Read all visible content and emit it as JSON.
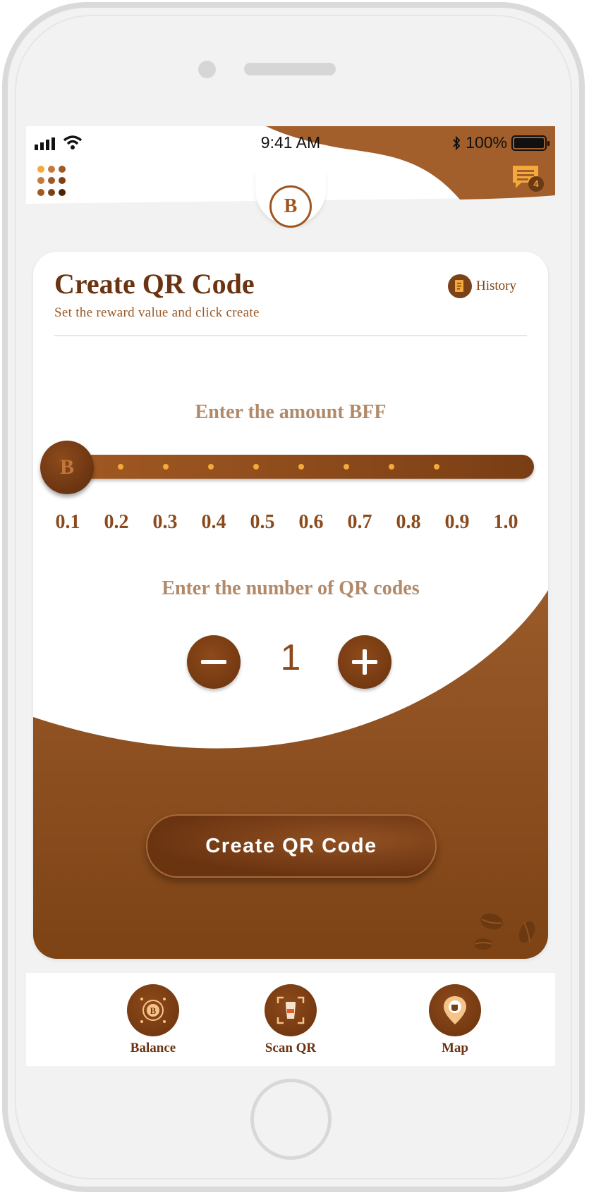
{
  "status_bar": {
    "time": "9:41 AM",
    "battery": "100%"
  },
  "header": {
    "chat_badge_count": "4",
    "logo_text": "B"
  },
  "card": {
    "title": "Create QR Code",
    "subtitle": "Set the reward value and click create",
    "history_label": "History",
    "amount_label": "Enter the amount BFF",
    "slider": {
      "ticks": [
        "0.1",
        "0.2",
        "0.3",
        "0.4",
        "0.5",
        "0.6",
        "0.7",
        "0.8",
        "0.9",
        "1.0"
      ],
      "selected": "0.1",
      "thumb_symbol": "B"
    },
    "qr_count_label": "Enter the number of QR codes",
    "qr_count": "1",
    "create_button": "Create QR Code"
  },
  "bottom_nav": {
    "items": [
      {
        "label": "Balance",
        "icon": "coin-icon"
      },
      {
        "label": "Scan QR",
        "icon": "coffee-cup-scan-icon"
      },
      {
        "label": "Map",
        "icon": "map-pin-icon"
      }
    ]
  },
  "colors": {
    "brand_dark": "#6a3412",
    "brand_mid": "#8a4a1c",
    "brand_light": "#a35a23",
    "accent": "#f5a93a",
    "muted_label": "#b08a6a"
  }
}
